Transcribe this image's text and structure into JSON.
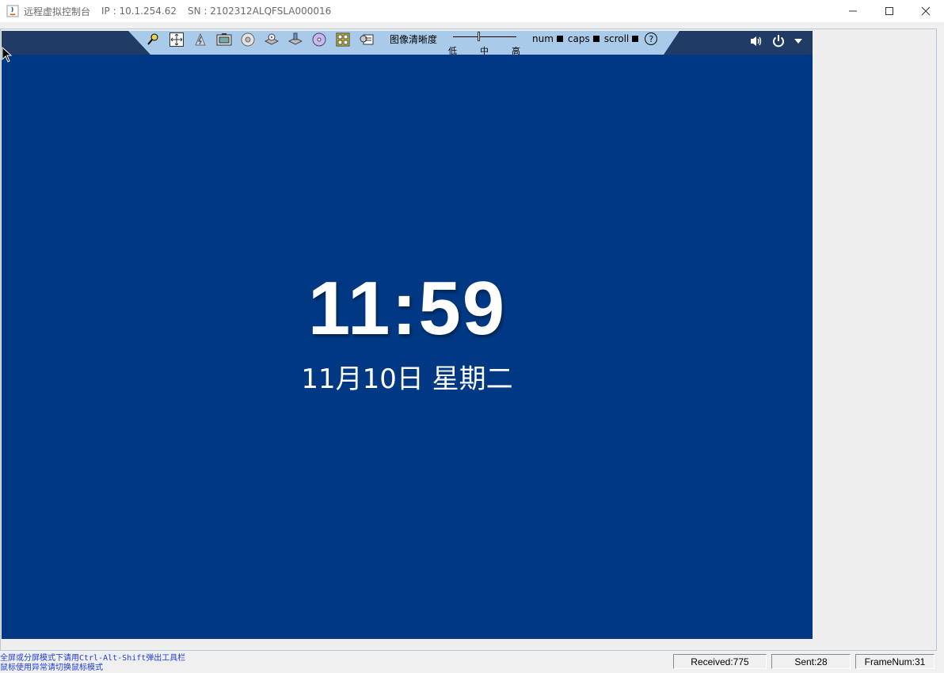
{
  "window": {
    "title": "远程虚拟控制台",
    "ip": "IP : 10.1.254.62",
    "sn": "SN : 2102312ALQFSLA000016",
    "buttons": [
      "minimize-icon",
      "maximize-icon",
      "close-icon"
    ]
  },
  "toolbar": {
    "icons": [
      "pin-icon",
      "move-icon",
      "shortcut-icon",
      "screenshot-icon",
      "floppy-icon",
      "cdrom-icon",
      "drive-icon",
      "dvd-icon",
      "keyboard-icon",
      "settings-icon"
    ],
    "clarity_label": "图像清晰度",
    "slider": {
      "low": "低",
      "mid": "中",
      "high": "高",
      "level": 0.4
    },
    "num_label": "num",
    "caps_label": "caps",
    "scroll_label": "scroll",
    "help_label": "?"
  },
  "controls": {
    "icons": [
      "volume-icon",
      "power-icon",
      "dropdown-icon"
    ]
  },
  "screen": {
    "time": "11:59",
    "date": "11月10日 星期二",
    "background": "#003883"
  },
  "status": {
    "hint_line1": "全屏或分屏模式下请用Ctrl-Alt-Shift弹出工具栏",
    "hint_line2": "鼠标使用异常请切换鼠标模式",
    "received": "Received:775",
    "sent": "Sent:28",
    "frame_num": "FrameNum:31"
  }
}
